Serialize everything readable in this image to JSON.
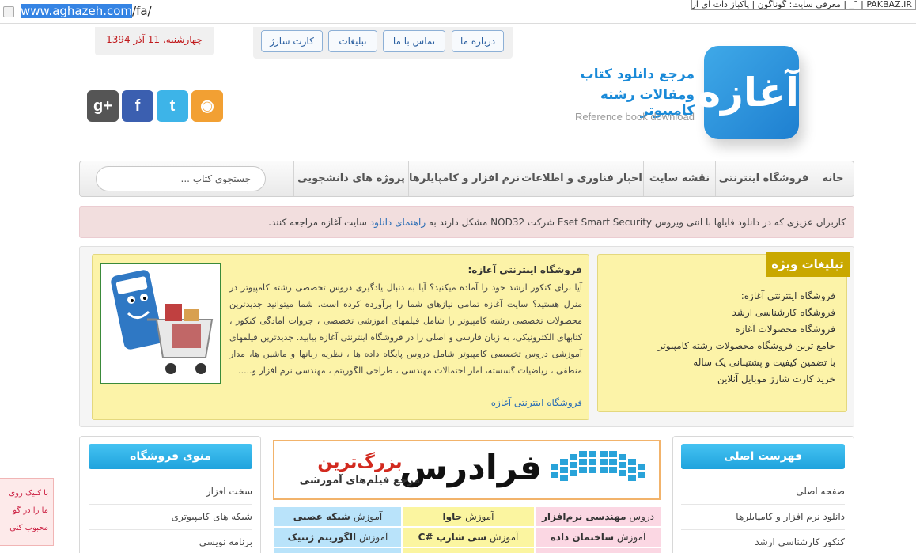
{
  "browser": {
    "url_host": "www.aghazeh.com",
    "url_path": "/fa/",
    "tab_title": "PAKBAZ.IR | ¯_ | معرفی سایت: گوناگون | پاکباز دات آی آر"
  },
  "header": {
    "date": "چهارشنبه، 11 آذر 1394",
    "top_links": [
      "درباره ما",
      "تماس با ما",
      "تبلیغات",
      "کارت شارژ"
    ],
    "logo_mark": "آغازه",
    "tagline_1": "مرجع دانلود کتاب",
    "tagline_2": "ومقالات رشته کامپیوتر",
    "tagline_en": "Reference book download",
    "social": [
      {
        "icon": "google-plus-icon",
        "glyph": "g+",
        "color": "#555555"
      },
      {
        "icon": "facebook-icon",
        "glyph": "f",
        "color": "#3b5fb0"
      },
      {
        "icon": "twitter-icon",
        "glyph": "t",
        "color": "#3db4e8"
      },
      {
        "icon": "rss-icon",
        "glyph": "◉",
        "color": "#f2a033"
      }
    ]
  },
  "nav": {
    "items": [
      "خانه",
      "فروشگاه اینترنتی",
      "نقشه سایت",
      "اخبار فناوری و اطلاعات",
      "نرم افزار و کامپایلرها",
      "پروژه های دانشجویی"
    ],
    "search_placeholder": "جستجوی کتاب ..."
  },
  "alert": {
    "part1": "کاربران عزیزی که در دانلود فایلها با انتی ویروس Eset Smart Security شرکت NOD32 مشکل دارند به",
    "link": "راهنمای دانلود",
    "part2": "سایت آغازه مراجعه کنند."
  },
  "ads": {
    "title": "تبلیغات ویژه",
    "lines": [
      {
        "text": "فروشگاه اینترنتی آغازه:",
        "link": false
      },
      {
        "text": "فروشگاه کارشناسی ارشد",
        "link": true
      },
      {
        "text": "فروشگاه محصولات آغازه",
        "link": true
      },
      {
        "text": "جامع ترین فروشگاه محصولات رشته کامپیوتر",
        "link": false
      },
      {
        "text": "با تضمین کیفیت و پشتیبانی یک ساله",
        "link": false
      },
      {
        "text": "خرید کارت شارژ موبایل آنلاین",
        "link": true
      }
    ]
  },
  "store": {
    "title": "فروشگاه اینترنتی آغازه:",
    "body": "آیا برای کنکور ارشد خود را آماده میکنید؟ آیا به دنبال یادگیری دروس تخصصی رشته کامپیوتر در منزل هستید؟ سایت آغازه تمامی نیازهای شما را برآورده کرده است. شما میتوانید جدیدترین محصولات تخصصی رشته کامپیوتر را شامل فیلمهای آموزشی تخصصی ، جزوات آمادگی کنکور ، کتابهای الکترونیکی، به زبان فارسی و اصلی را در فروشگاه اینترنتی آغازه بیابید. جدیدترین فیلمهای آموزشی دروس تخصصی کامپیوتر شامل دروس پایگاه داده ها ، نظریه زبانها و ماشین ها، مدار منطقی ، ریاضیات گسسته، آمار احتمالات مهندسی ، طراحی الگوریتم ، مهندسی نرم افزار و.....",
    "link": "فروشگاه اینترنتی آغازه"
  },
  "main_menu": {
    "title": "فهرست اصلی",
    "items": [
      "صفحه اصلی",
      "دانلود نرم افزار و کامپایلرها",
      "کنکور کارشناسی ارشد"
    ]
  },
  "shop_menu": {
    "title": "منوی فروشگاه",
    "items": [
      "سخت افزار",
      "شبکه های کامپیوتری",
      "برنامه نویسی"
    ]
  },
  "banner": {
    "brand": "فرادرس",
    "line1": "بزرگ‌ترین",
    "line2": "مرجع فیلم‌های آموزشی"
  },
  "courses": [
    {
      "prefix": "دروس",
      "bold": "مهندسی نرم‌افزار",
      "color": "pink"
    },
    {
      "prefix": "آموزش",
      "bold": "جاوا",
      "color": "yellow"
    },
    {
      "prefix": "آموزش",
      "bold": "شبکه عصبی",
      "color": "blue"
    },
    {
      "prefix": "آموزش",
      "bold": "ساختمان داده",
      "color": "pink"
    },
    {
      "prefix": "آموزش",
      "bold": "سی شارپ #C",
      "color": "yellow"
    },
    {
      "prefix": "آموزش",
      "bold": "الگوریتم ژنتیک",
      "color": "blue"
    }
  ],
  "side_notice": {
    "lines": [
      "با کلیک روی",
      "ما را در گو",
      "محبوب کنی"
    ]
  }
}
